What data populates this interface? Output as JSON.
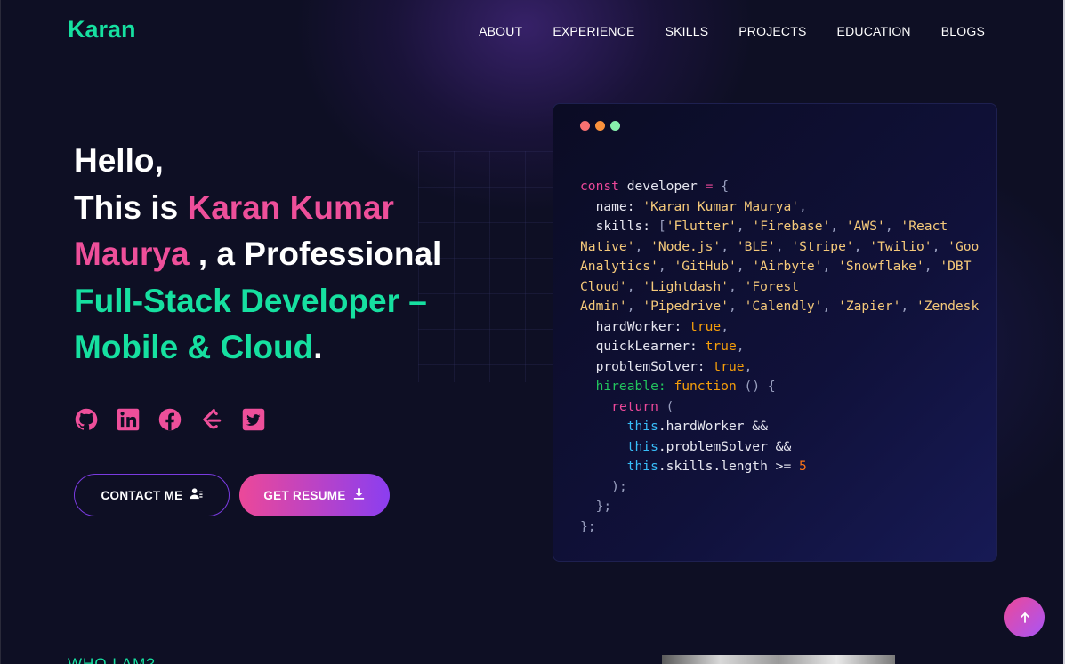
{
  "brand": "Karan",
  "nav": {
    "items": [
      "ABOUT",
      "EXPERIENCE",
      "SKILLS",
      "PROJECTS",
      "EDUCATION",
      "BLOGS"
    ]
  },
  "hero": {
    "hello": "Hello,",
    "this_is": "This is ",
    "name": "Karan Kumar Maurya",
    "professional": " , a Professional",
    "role": "Full-Stack Developer – Mobile & Cloud",
    "period": "."
  },
  "socials": [
    "github-icon",
    "linkedin-icon",
    "facebook-icon",
    "leetcode-icon",
    "twitter-icon"
  ],
  "buttons": {
    "contact": "CONTACT ME",
    "resume": "GET RESUME"
  },
  "code": {
    "window_dots": [
      "#f87171",
      "#fb923c",
      "#86efac"
    ],
    "declaration_kw": "const",
    "declaration_name": "developer",
    "name_key": "name:",
    "name_value": "'Karan Kumar Maurya'",
    "skills_key": "skills:",
    "skills": [
      "Flutter",
      "Firebase",
      "AWS",
      "React Native",
      "Node.js",
      "BLE",
      "Stripe",
      "Twilio",
      "Google Analytics",
      "GitHub",
      "Airbyte",
      "Snowflake",
      "DBT Cloud",
      "Lightdash",
      "Forest Admin",
      "Pipedrive",
      "Calendly",
      "Zapier",
      "Zendesk"
    ],
    "hardWorker_key": "hardWorker:",
    "quickLearner_key": "quickLearner:",
    "problemSolver_key": "problemSolver:",
    "bool_value": "true",
    "hireable_key": "hireable:",
    "function_kw": "function",
    "return_kw": "return",
    "this_kw": "this",
    "cond1": ".hardWorker &&",
    "cond2": ".problemSolver &&",
    "cond3": ".skills.length >= ",
    "min_skills": "5"
  },
  "next_section": {
    "title": "WHO I AM?"
  },
  "colors": {
    "background": "#0e0f24",
    "accent_green": "#16e0a0",
    "accent_pink": "#ee4f9a",
    "accent_purple": "#8b3ef0"
  }
}
